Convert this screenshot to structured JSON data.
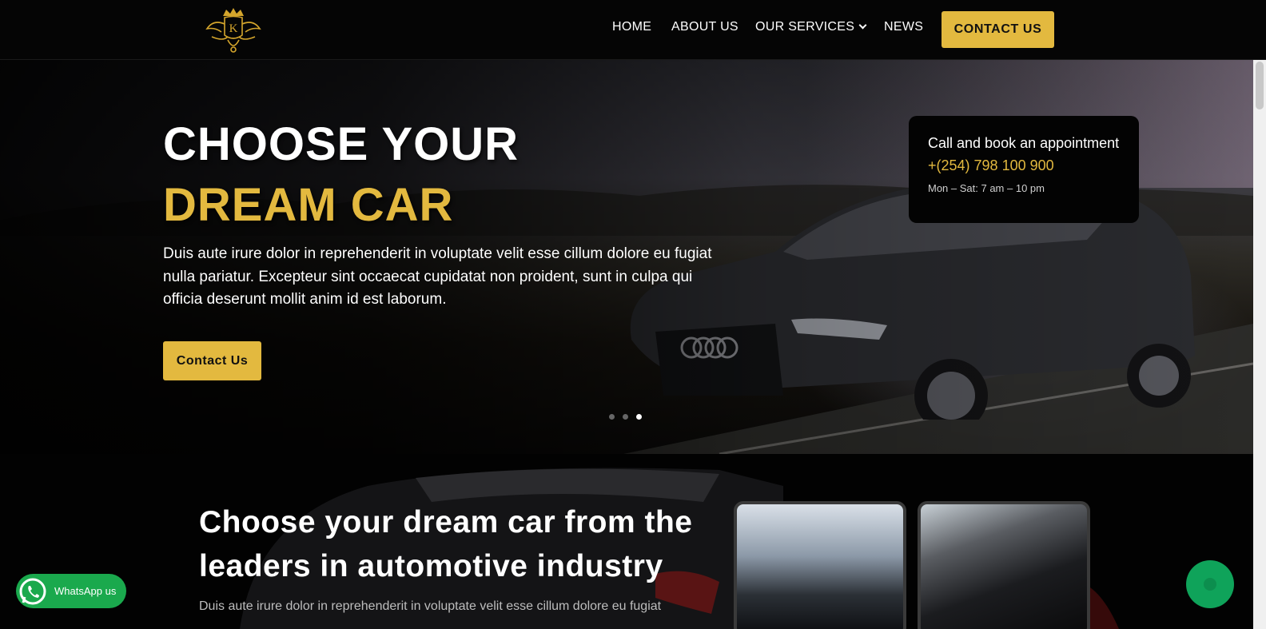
{
  "header": {
    "logo_letter": "K",
    "nav": {
      "home": "HOME",
      "about": "ABOUT US",
      "services": "OUR SERVICES",
      "news": "NEWS",
      "contact": "CONTACT US"
    }
  },
  "hero": {
    "title_line1": "CHOOSE YOUR",
    "title_line2": "DREAM CAR",
    "text": "Duis aute irure dolor in reprehenderit in voluptate velit esse cillum dolore eu fugiat nulla pariatur. Excepteur sint occaecat cupidatat non proident, sunt in culpa qui officia deserunt mollit anim id est laborum.",
    "button": "Contact Us",
    "slides": {
      "count": 3,
      "active": 3
    }
  },
  "booking": {
    "title": "Call and book an appointment",
    "phone": "+(254) 798 100 900",
    "hours": "Mon – Sat: 7 am – 10 pm"
  },
  "section2": {
    "title": "Choose your dream car from the leaders in automotive industry",
    "text": "Duis aute irure dolor in reprehenderit in voluptate velit esse cillum dolore eu fugiat"
  },
  "whatsapp": {
    "label": "WhatsApp us"
  },
  "colors": {
    "accent": "#e3b93f",
    "whatsapp": "#1aa94d",
    "chat": "#0fa35a"
  }
}
